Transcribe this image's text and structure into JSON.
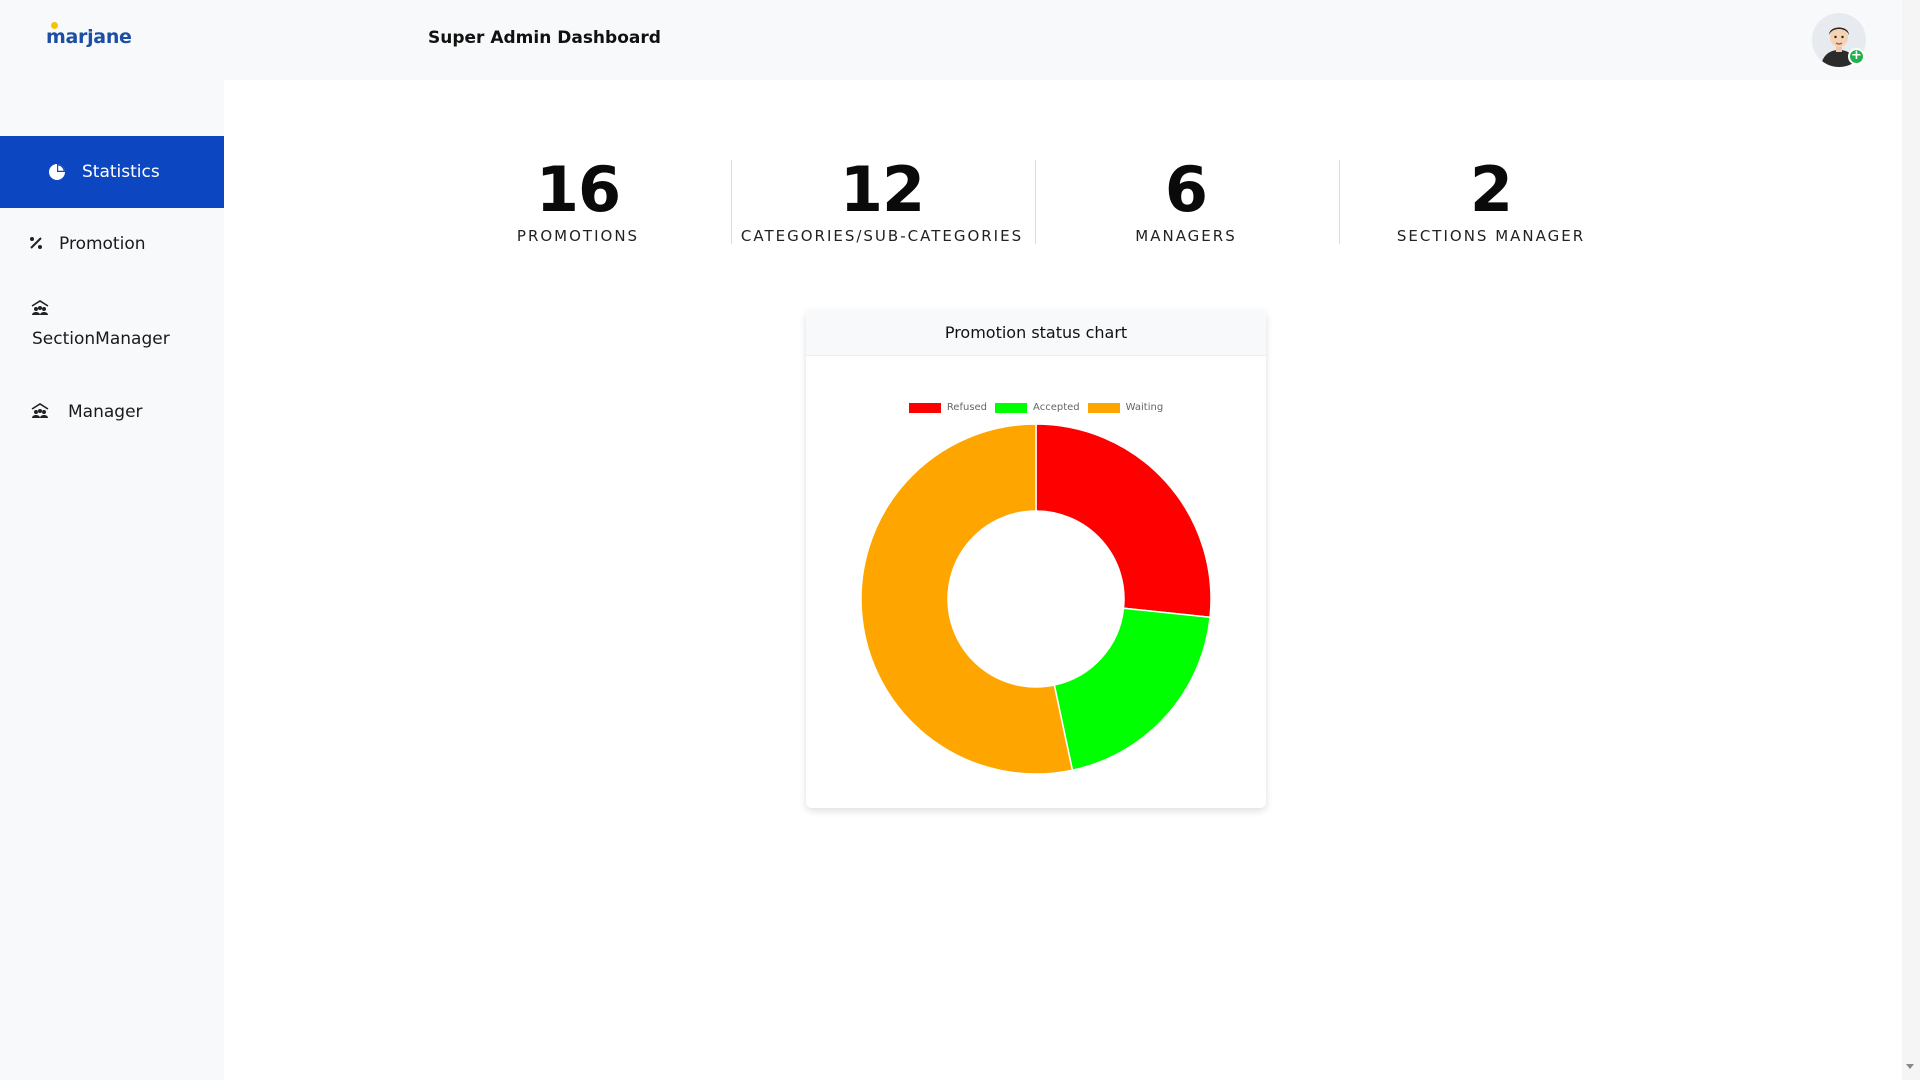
{
  "app": {
    "logo_text": "marjane",
    "title": "Super Admin Dashboard"
  },
  "sidebar": {
    "items": [
      {
        "label": "Statistics",
        "icon": "pie-chart-icon",
        "active": true
      },
      {
        "label": "Promotion",
        "icon": "percent-icon",
        "active": false
      },
      {
        "label": "SectionManager",
        "icon": "users-icon",
        "active": false
      },
      {
        "label": "Manager",
        "icon": "users-icon",
        "active": false
      }
    ]
  },
  "stats": [
    {
      "value": "16",
      "label": "PROMOTIONS"
    },
    {
      "value": "12",
      "label": "CATEGORIES/SUB-CATEGORIES"
    },
    {
      "value": "6",
      "label": "MANAGERS"
    },
    {
      "value": "2",
      "label": "SECTIONS MANAGER"
    }
  ],
  "card": {
    "title": "Promotion status chart"
  },
  "colors": {
    "primary": "#0d46c1",
    "refused": "#ff0000",
    "accepted": "#00ff00",
    "waiting": "#ffa500"
  },
  "chart_data": {
    "type": "pie",
    "title": "",
    "categories": [
      "Refused",
      "Accepted",
      "Waiting"
    ],
    "values": [
      4,
      3,
      8
    ],
    "colors": [
      "#ff0000",
      "#00ff00",
      "#ffa500"
    ],
    "legend": "top",
    "doughnut": true
  }
}
